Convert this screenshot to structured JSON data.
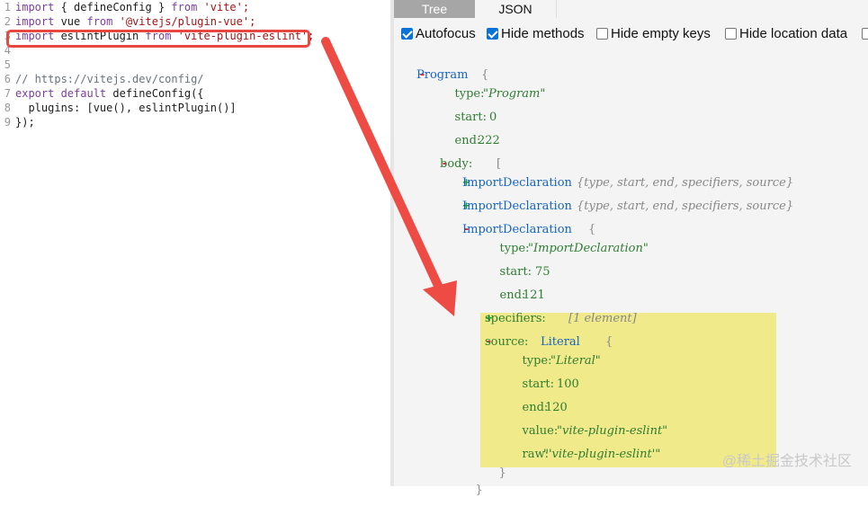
{
  "editor": {
    "lines": [
      {
        "num": "1",
        "parts": [
          {
            "t": "import",
            "c": "kw"
          },
          {
            "t": " { defineConfig } ",
            "c": "plain"
          },
          {
            "t": "from",
            "c": "kw"
          },
          {
            "t": " 'vite';",
            "c": "str"
          }
        ]
      },
      {
        "num": "2",
        "parts": [
          {
            "t": "import",
            "c": "kw"
          },
          {
            "t": " vue ",
            "c": "plain"
          },
          {
            "t": "from",
            "c": "kw"
          },
          {
            "t": " '@vitejs/plugin-vue';",
            "c": "str"
          }
        ]
      },
      {
        "num": "3",
        "parts": [
          {
            "t": "import",
            "c": "kw"
          },
          {
            "t": " eslintPlugin ",
            "c": "plain"
          },
          {
            "t": "from",
            "c": "kw"
          },
          {
            "t": " 'vite-plugin-eslint';",
            "c": "str"
          }
        ]
      },
      {
        "num": "4",
        "parts": []
      },
      {
        "num": "5",
        "parts": []
      },
      {
        "num": "6",
        "parts": [
          {
            "t": "// https://vitejs.dev/config/",
            "c": "cm"
          }
        ]
      },
      {
        "num": "7",
        "parts": [
          {
            "t": "export default",
            "c": "kw"
          },
          {
            "t": " defineConfig({",
            "c": "plain"
          }
        ]
      },
      {
        "num": "8",
        "parts": [
          {
            "t": "  plugins: [vue(), eslintPlugin()]",
            "c": "plain"
          }
        ]
      },
      {
        "num": "9",
        "parts": [
          {
            "t": "});",
            "c": "plain"
          }
        ]
      }
    ]
  },
  "tabs": {
    "tree": "Tree",
    "json": "JSON"
  },
  "options": [
    {
      "label": "Autofocus",
      "checked": true
    },
    {
      "label": "Hide methods",
      "checked": true
    },
    {
      "label": "Hide empty keys",
      "checked": false
    },
    {
      "label": "Hide location data",
      "checked": false
    }
  ],
  "tree": {
    "program": "Program",
    "program_type": "\"Program\"",
    "program_start": "0",
    "program_end": "222",
    "body_key": "body:",
    "decl_name": "ImportDeclaration",
    "decl_summary": "{type, start, end, specifiers, source}",
    "decl3_type": "\"ImportDeclaration\"",
    "decl3_start": "75",
    "decl3_end": "121",
    "specifiers_key": "specifiers:",
    "specifiers_summary": "[1 element]",
    "source_key": "source:",
    "source_class": "Literal",
    "lit_type": "\"Literal\"",
    "lit_start": "100",
    "lit_end": "120",
    "lit_value": "\"vite-plugin-eslint\"",
    "lit_raw": "\"'vite-plugin-eslint'\"",
    "keys": {
      "type": "type:",
      "start": "start:",
      "end": "end:",
      "value": "value:",
      "raw": "raw:"
    },
    "open_brace": "{",
    "close_brace": "}",
    "open_bracket": "[",
    "minus": "-",
    "plus": "+"
  },
  "colors": {
    "highlight": "#f1ea8a",
    "arrow": "#ef4b45",
    "box": "#e8463f"
  },
  "watermark": "@稀土掘金技术社区"
}
